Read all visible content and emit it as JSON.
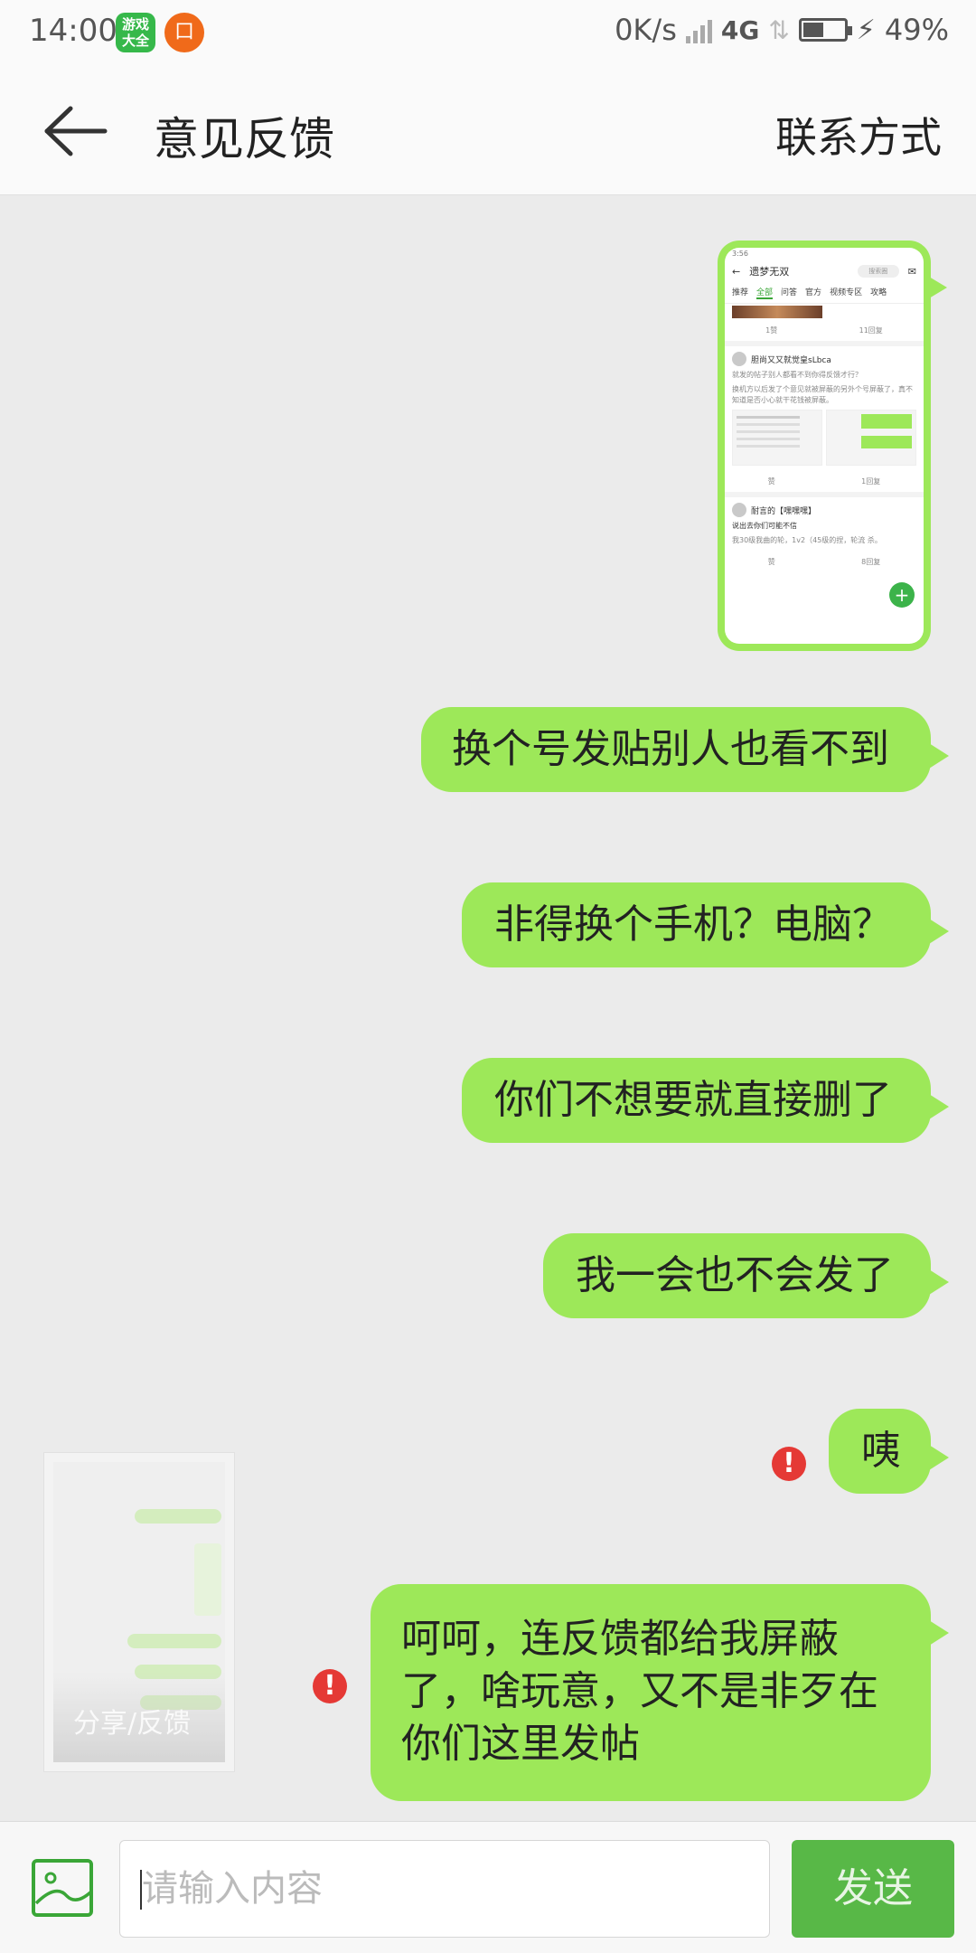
{
  "status_bar": {
    "time": "14:00",
    "app_icon_1_text": "游戏大全",
    "app_icon_2_text": "口",
    "net_speed": "0K/s",
    "network_type": "4G",
    "battery_percent": "49%",
    "battery_level": 0.49
  },
  "header": {
    "back_icon": "arrow-left-icon",
    "title": "意见反馈",
    "contact_label": "联系方式"
  },
  "image_message": {
    "mini_status": "3:56",
    "mini_title": "遗梦无双",
    "mini_search": "搜索圈",
    "mini_tabs": [
      "推荐",
      "全部",
      "问答",
      "官方",
      "视频专区",
      "攻略"
    ],
    "mini_active_tab": 1,
    "mini_like": "1赞",
    "mini_reply": "11回复",
    "mini_user_1": "胆尚又又就觉皇sLbca",
    "mini_post_1_title": "就发的帖子别人都看不到你得反馈才行？",
    "mini_post_1_text": "换机方以后发了个意见就被屏蔽的另外个号屏蔽了，真不知道是否小心就干花钱被屏蔽。",
    "mini_like_2": "赞",
    "mini_reply_2": "1回复",
    "mini_user_2": "耐言的【嘿嘿嘿】",
    "mini_post_2_title": "说出去你们可能不信",
    "mini_post_2_text": "我30级我曲的轮，1v2（45级的捏，轮流 杀。",
    "mini_like_3": "赞",
    "mini_reply_3": "8回复"
  },
  "messages": [
    {
      "text": "换个号发贴别人也看不到",
      "failed": false
    },
    {
      "text": "非得换个手机？电脑？",
      "failed": false
    },
    {
      "text": "你们不想要就直接删了",
      "failed": false
    },
    {
      "text": "我一会也不会发了",
      "failed": false
    },
    {
      "text": "咦",
      "failed": true
    },
    {
      "lines": [
        "呵呵，连反馈都给我屏蔽",
        "了，啥玩意，又不是非歹在",
        "你们这里发帖"
      ],
      "failed": true
    }
  ],
  "error_icon": "!",
  "share_overlay": {
    "label": "分享/反馈"
  },
  "input_bar": {
    "image_button_icon": "image-icon",
    "placeholder": "请输入内容",
    "send_label": "发送"
  },
  "colors": {
    "bubble_green": "#9de859",
    "send_green": "#58b847",
    "error_red": "#e53935",
    "background": "#ebebeb"
  }
}
